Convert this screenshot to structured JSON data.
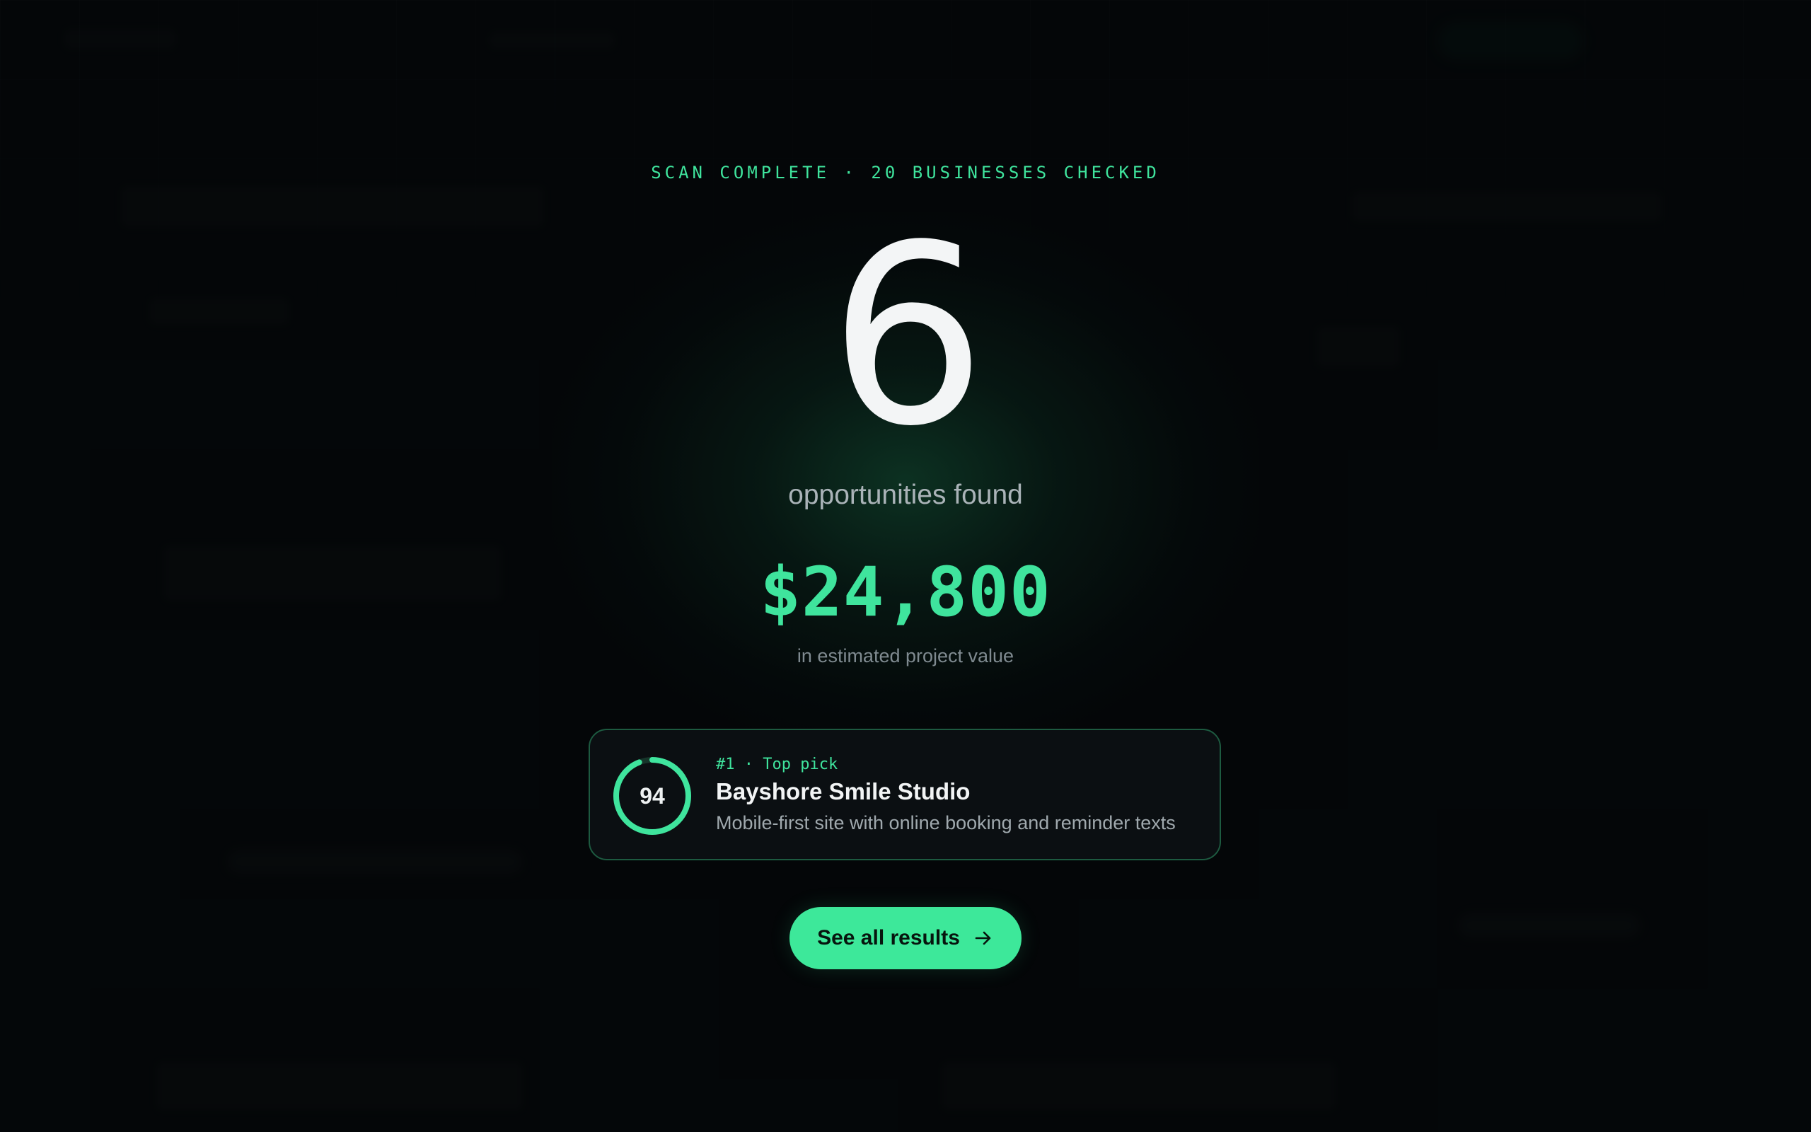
{
  "scan": {
    "status": "SCAN COMPLETE · 20 BUSINESSES CHECKED"
  },
  "result": {
    "count": "6",
    "count_label": "opportunities found",
    "value": "$24,800",
    "value_label": "in estimated project value"
  },
  "top_pick": {
    "score": "94",
    "score_fraction": 0.94,
    "meta": "#1 · Top pick",
    "name": "Bayshore Smile Studio",
    "description": "Mobile-first site with online booking and reminder texts"
  },
  "cta": {
    "label": "See all results",
    "icon": "arrow-right-icon"
  },
  "colors": {
    "background": "#05080a",
    "accent": "#3fe49d",
    "card_border": "#1d5a40"
  }
}
